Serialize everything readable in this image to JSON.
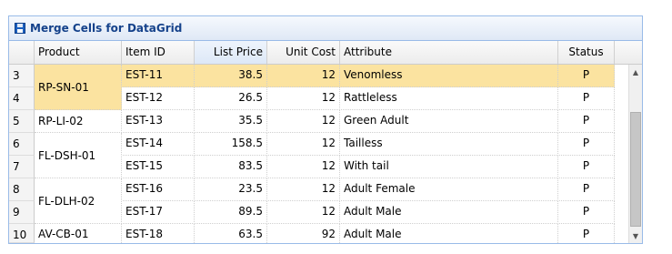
{
  "panel": {
    "title": "Merge Cells for DataGrid",
    "icon": "save-icon"
  },
  "columns": [
    "Product",
    "Item ID",
    "List Price",
    "Unit Cost",
    "Attribute",
    "Status"
  ],
  "rows": [
    {
      "num": "3",
      "item": "EST-11",
      "price": "38.5",
      "cost": "12",
      "attr": "Venomless",
      "status": "P"
    },
    {
      "num": "4",
      "item": "EST-12",
      "price": "26.5",
      "cost": "12",
      "attr": "Rattleless",
      "status": "P"
    },
    {
      "num": "5",
      "item": "EST-13",
      "price": "35.5",
      "cost": "12",
      "attr": "Green Adult",
      "status": "P"
    },
    {
      "num": "6",
      "item": "EST-14",
      "price": "158.5",
      "cost": "12",
      "attr": "Tailless",
      "status": "P"
    },
    {
      "num": "7",
      "item": "EST-15",
      "price": "83.5",
      "cost": "12",
      "attr": "With tail",
      "status": "P"
    },
    {
      "num": "8",
      "item": "EST-16",
      "price": "23.5",
      "cost": "12",
      "attr": "Adult Female",
      "status": "P"
    },
    {
      "num": "9",
      "item": "EST-17",
      "price": "89.5",
      "cost": "12",
      "attr": "Adult Male",
      "status": "P"
    },
    {
      "num": "10",
      "item": "EST-18",
      "price": "63.5",
      "cost": "92",
      "attr": "Adult Male",
      "status": "P"
    }
  ],
  "products": [
    "RP-SN-01",
    "RP-LI-02",
    "FL-DSH-01",
    "FL-DLH-02",
    "AV-CB-01"
  ],
  "colors": {
    "selected_row": "#fbe3a0",
    "title_text": "#15428b",
    "panel_border": "#99bbe8"
  }
}
